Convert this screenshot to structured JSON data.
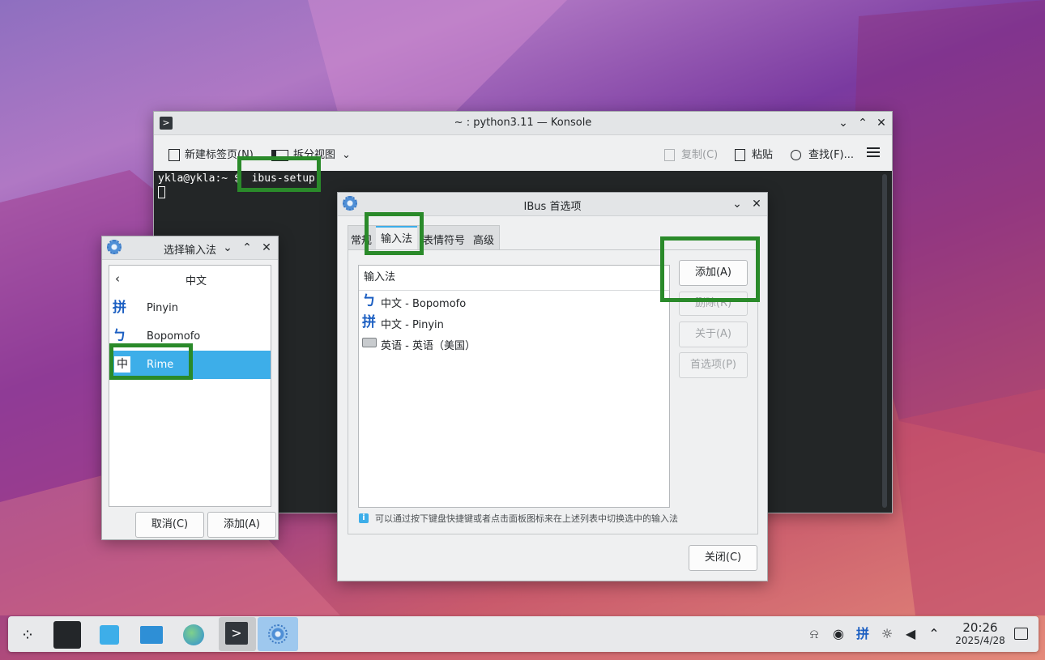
{
  "colors": {
    "accent": "#3daee9",
    "highlight_box": "#2a8a2a",
    "terminal_bg": "#232627"
  },
  "konsole": {
    "title": "~ : python3.11 — Konsole",
    "toolbar": {
      "new_tab": "新建标签页(N)",
      "split_view": "拆分视图",
      "copy": "复制(C)",
      "paste": "粘贴",
      "find": "查找(F)..."
    },
    "prompt": "ykla@ykla:~ $",
    "command": "ibus-setup"
  },
  "ibus_prefs": {
    "title": "IBus 首选项",
    "tabs": [
      "常规",
      "输入法",
      "表情符号",
      "高级"
    ],
    "list_header": "输入法",
    "items": [
      "中文 - Bopomofo",
      "中文 - Pinyin",
      "英语 - 英语（美国）"
    ],
    "buttons": {
      "add": "添加(A)",
      "remove": "删除(R)",
      "about": "关于(A)",
      "prefs": "首选项(P)",
      "close": "关闭(C)"
    },
    "hint": "可以通过按下键盘快捷键或者点击面板图标来在上述列表中切换选中的输入法"
  },
  "select_ime": {
    "title": "选择输入法",
    "back_label": "中文",
    "items": [
      {
        "icon": "拼",
        "label": "Pinyin"
      },
      {
        "icon": "ㄅ",
        "label": "Bopomofo"
      },
      {
        "icon": "中",
        "label": "Rime"
      }
    ],
    "buttons": {
      "cancel": "取消(C)",
      "add": "添加(A)"
    }
  },
  "taskbar": {
    "ime_indicator": "拼",
    "time": "20:26",
    "date": "2025/4/28"
  }
}
